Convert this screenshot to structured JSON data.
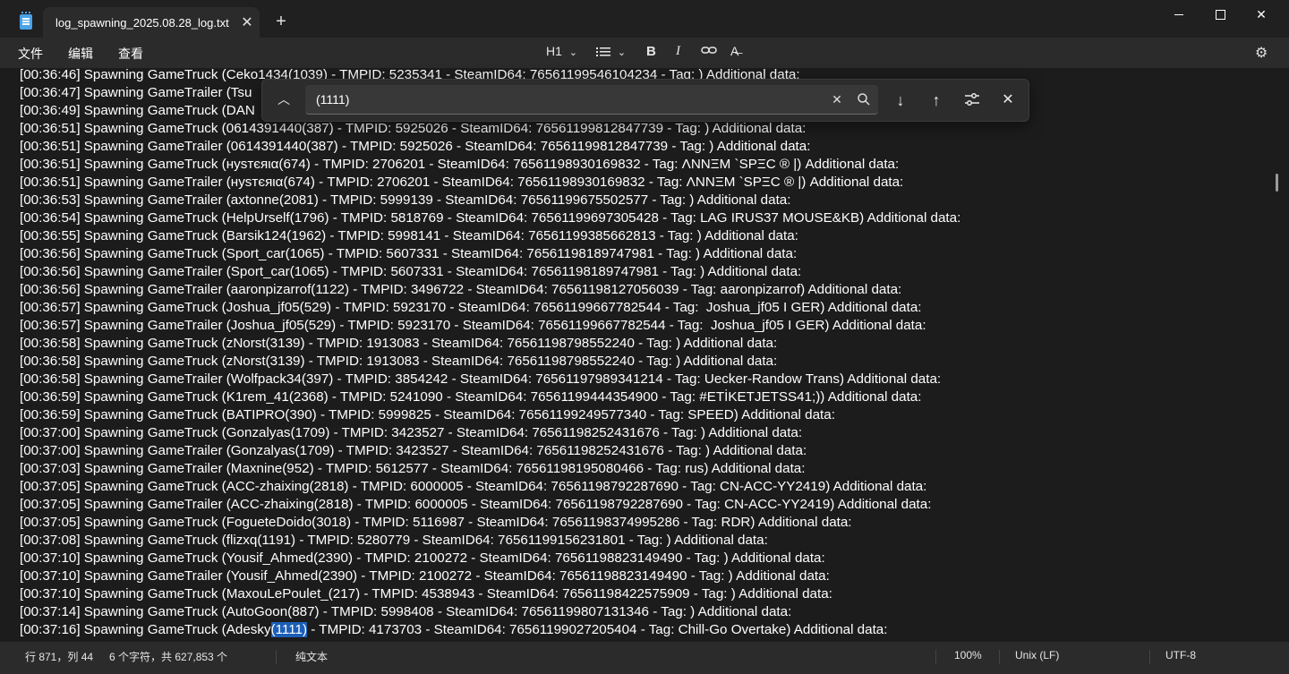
{
  "tab": {
    "title": "log_spawning_2025.08.28_log.txt",
    "close": "✕"
  },
  "window": {
    "new_tab": "+",
    "close": "✕"
  },
  "menu": [
    "文件",
    "编辑",
    "查看"
  ],
  "format": {
    "heading": "H1",
    "chevron": "⌄",
    "bold": "B",
    "italic": "I",
    "clear": "A̶"
  },
  "find": {
    "query": "(1111)",
    "clear": "✕",
    "down": "↓",
    "up": "↑",
    "options": "⚙",
    "close": "✕",
    "collapse": "︿"
  },
  "lines": [
    "[00:36:46] Spawning GameTruck (Ceko1434(1039) - TMPID: 5235341 - SteamID64: 76561199546104234 - Tag: ) Additional data:",
    "[00:36:47] Spawning GameTrailer (Tsu",
    "[00:36:49] Spawning GameTruck (DAN",
    "[00:36:51] Spawning GameTruck (0614391440(387) - TMPID: 5925026 - SteamID64: 76561199812847739 - Tag: ) Additional data:",
    "[00:36:51] Spawning GameTrailer (0614391440(387) - TMPID: 5925026 - SteamID64: 76561199812847739 - Tag: ) Additional data:",
    "[00:36:51] Spawning GameTruck (нуsтєяια(674) - TMPID: 2706201 - SteamID64: 76561198930169832 - Tag: ΛΝΝΞΜ `SPΞC ® |) Additional data:",
    "[00:36:51] Spawning GameTrailer (нуsтєяια(674) - TMPID: 2706201 - SteamID64: 76561198930169832 - Tag: ΛΝΝΞΜ `SPΞC ® |) Additional data:",
    "[00:36:53] Spawning GameTrailer (axtonne(2081) - TMPID: 5999139 - SteamID64: 76561199675502577 - Tag: ) Additional data:",
    "[00:36:54] Spawning GameTruck (HelpUrself(1796) - TMPID: 5818769 - SteamID64: 76561199697305428 - Tag: LAG IRUS37 MOUSE&KB) Additional data:",
    "[00:36:55] Spawning GameTruck (Barsik124(1962) - TMPID: 5998141 - SteamID64: 76561199385662813 - Tag: ) Additional data:",
    "[00:36:56] Spawning GameTruck (Sport_car(1065) - TMPID: 5607331 - SteamID64: 76561198189747981 - Tag: ) Additional data:",
    "[00:36:56] Spawning GameTrailer (Sport_car(1065) - TMPID: 5607331 - SteamID64: 76561198189747981 - Tag: ) Additional data:",
    "[00:36:56] Spawning GameTrailer (aaronpizarrof(1122) - TMPID: 3496722 - SteamID64: 76561198127056039 - Tag: aaronpizarrof) Additional data:",
    "[00:36:57] Spawning GameTruck (Joshua_jf05(529) - TMPID: 5923170 - SteamID64: 76561199667782544 - Tag:  Joshua_jf05 I GER) Additional data:",
    "[00:36:57] Spawning GameTrailer (Joshua_jf05(529) - TMPID: 5923170 - SteamID64: 76561199667782544 - Tag:  Joshua_jf05 I GER) Additional data:",
    "[00:36:58] Spawning GameTruck (zNorst(3139) - TMPID: 1913083 - SteamID64: 76561198798552240 - Tag: ) Additional data:",
    "[00:36:58] Spawning GameTruck (zNorst(3139) - TMPID: 1913083 - SteamID64: 76561198798552240 - Tag: ) Additional data:",
    "[00:36:58] Spawning GameTrailer (Wolfpack34(397) - TMPID: 3854242 - SteamID64: 76561197989341214 - Tag: Uecker-Randow Trans) Additional data:",
    "[00:36:59] Spawning GameTruck (K1rem_41(2368) - TMPID: 5241090 - SteamID64: 76561199444354900 - Tag: #ETİKETJETSS41;)) Additional data:",
    "[00:36:59] Spawning GameTruck (BATIPRO(390) - TMPID: 5999825 - SteamID64: 76561199249577340 - Tag: SPEED) Additional data:",
    "[00:37:00] Spawning GameTruck (Gonzalyas(1709) - TMPID: 3423527 - SteamID64: 76561198252431676 - Tag: ) Additional data:",
    "[00:37:00] Spawning GameTrailer (Gonzalyas(1709) - TMPID: 3423527 - SteamID64: 76561198252431676 - Tag: ) Additional data:",
    "[00:37:03] Spawning GameTrailer (Maxnine(952) - TMPID: 5612577 - SteamID64: 76561198195080466 - Tag: rus) Additional data:",
    "[00:37:05] Spawning GameTruck (ACC-zhaixing(2818) - TMPID: 6000005 - SteamID64: 76561198792287690 - Tag: CN-ACC-YY2419) Additional data:",
    "[00:37:05] Spawning GameTrailer (ACC-zhaixing(2818) - TMPID: 6000005 - SteamID64: 76561198792287690 - Tag: CN-ACC-YY2419) Additional data:",
    "[00:37:05] Spawning GameTruck (FogueteDoido(3018) - TMPID: 5116987 - SteamID64: 76561198374995286 - Tag: RDR) Additional data:",
    "[00:37:08] Spawning GameTruck (flizxq(1191) - TMPID: 5280779 - SteamID64: 76561199156231801 - Tag: ) Additional data:",
    "[00:37:10] Spawning GameTruck (Yousif_Ahmed(2390) - TMPID: 2100272 - SteamID64: 76561198823149490 - Tag: ) Additional data:",
    "[00:37:10] Spawning GameTrailer (Yousif_Ahmed(2390) - TMPID: 2100272 - SteamID64: 76561198823149490 - Tag: ) Additional data:",
    "[00:37:10] Spawning GameTruck (MaxouLePoulet_(217) - TMPID: 4538943 - SteamID64: 76561198422575909 - Tag: ) Additional data:",
    "[00:37:14] Spawning GameTruck (AutoGoon(887) - TMPID: 5998408 - SteamID64: 76561199807131346 - Tag: ) Additional data:"
  ],
  "last_line": {
    "before": "[00:37:16] Spawning GameTruck (Adesky",
    "match": "(1111)",
    "after": " - TMPID: 4173703 - SteamID64: 76561199027205404 - Tag: Chill-Go Overtake) Additional data:"
  },
  "status": {
    "position": "行 871，列 44",
    "selection": "6 个字符，共 627,853 个",
    "mode": "纯文本",
    "zoom": "100%",
    "eol": "Unix (LF)",
    "encoding": "UTF-8"
  },
  "colors": {
    "background": "#1c1c1c",
    "chrome": "#2b2b2b",
    "highlight": "#1c5fb8"
  }
}
